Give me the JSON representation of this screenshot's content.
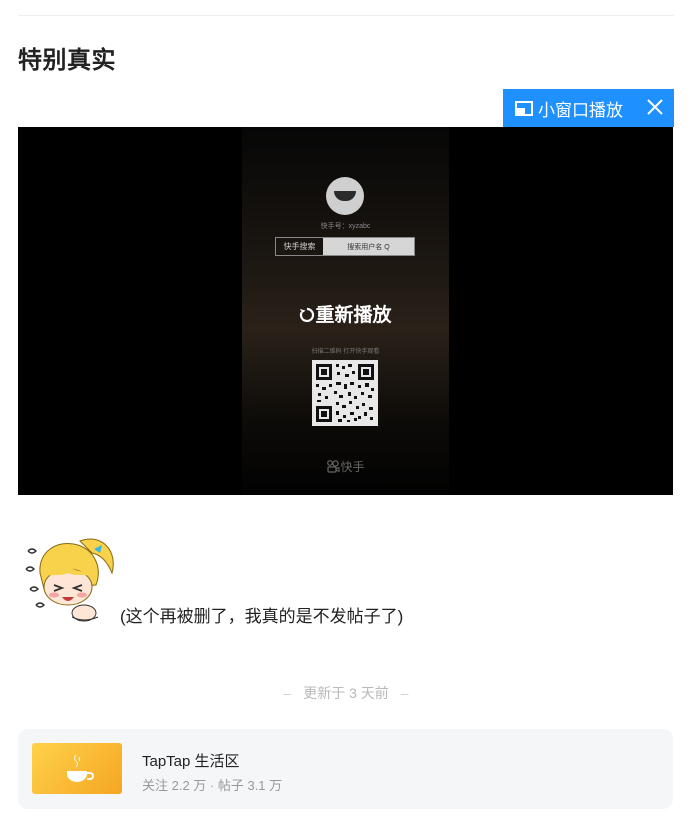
{
  "post": {
    "title": "特别真实",
    "body_text": "(这个再被删了，我真的是不发帖子了)",
    "updated": "更新于 3 天前"
  },
  "player": {
    "pip_label": "小窗口播放",
    "replay_label": "重新播放",
    "overlay": {
      "id_text": "快手号：xyzabc",
      "search_label": "快手搜索",
      "search_value": "搜索用户名 Q",
      "scan_hint": "扫描二维码 打开快手观看",
      "brand": "快手"
    }
  },
  "forum": {
    "name": "TapTap 生活区",
    "stats": "关注 2.2 万 · 帖子 3.1 万"
  },
  "colors": {
    "accent": "#1e90ff",
    "card_bg": "#f5f6f8",
    "thumb": "#f5b72a"
  },
  "icons": [
    "picture-in-picture-icon",
    "close-icon",
    "replay-icon",
    "coffee-cup-icon",
    "kuaishou-logo-icon"
  ]
}
